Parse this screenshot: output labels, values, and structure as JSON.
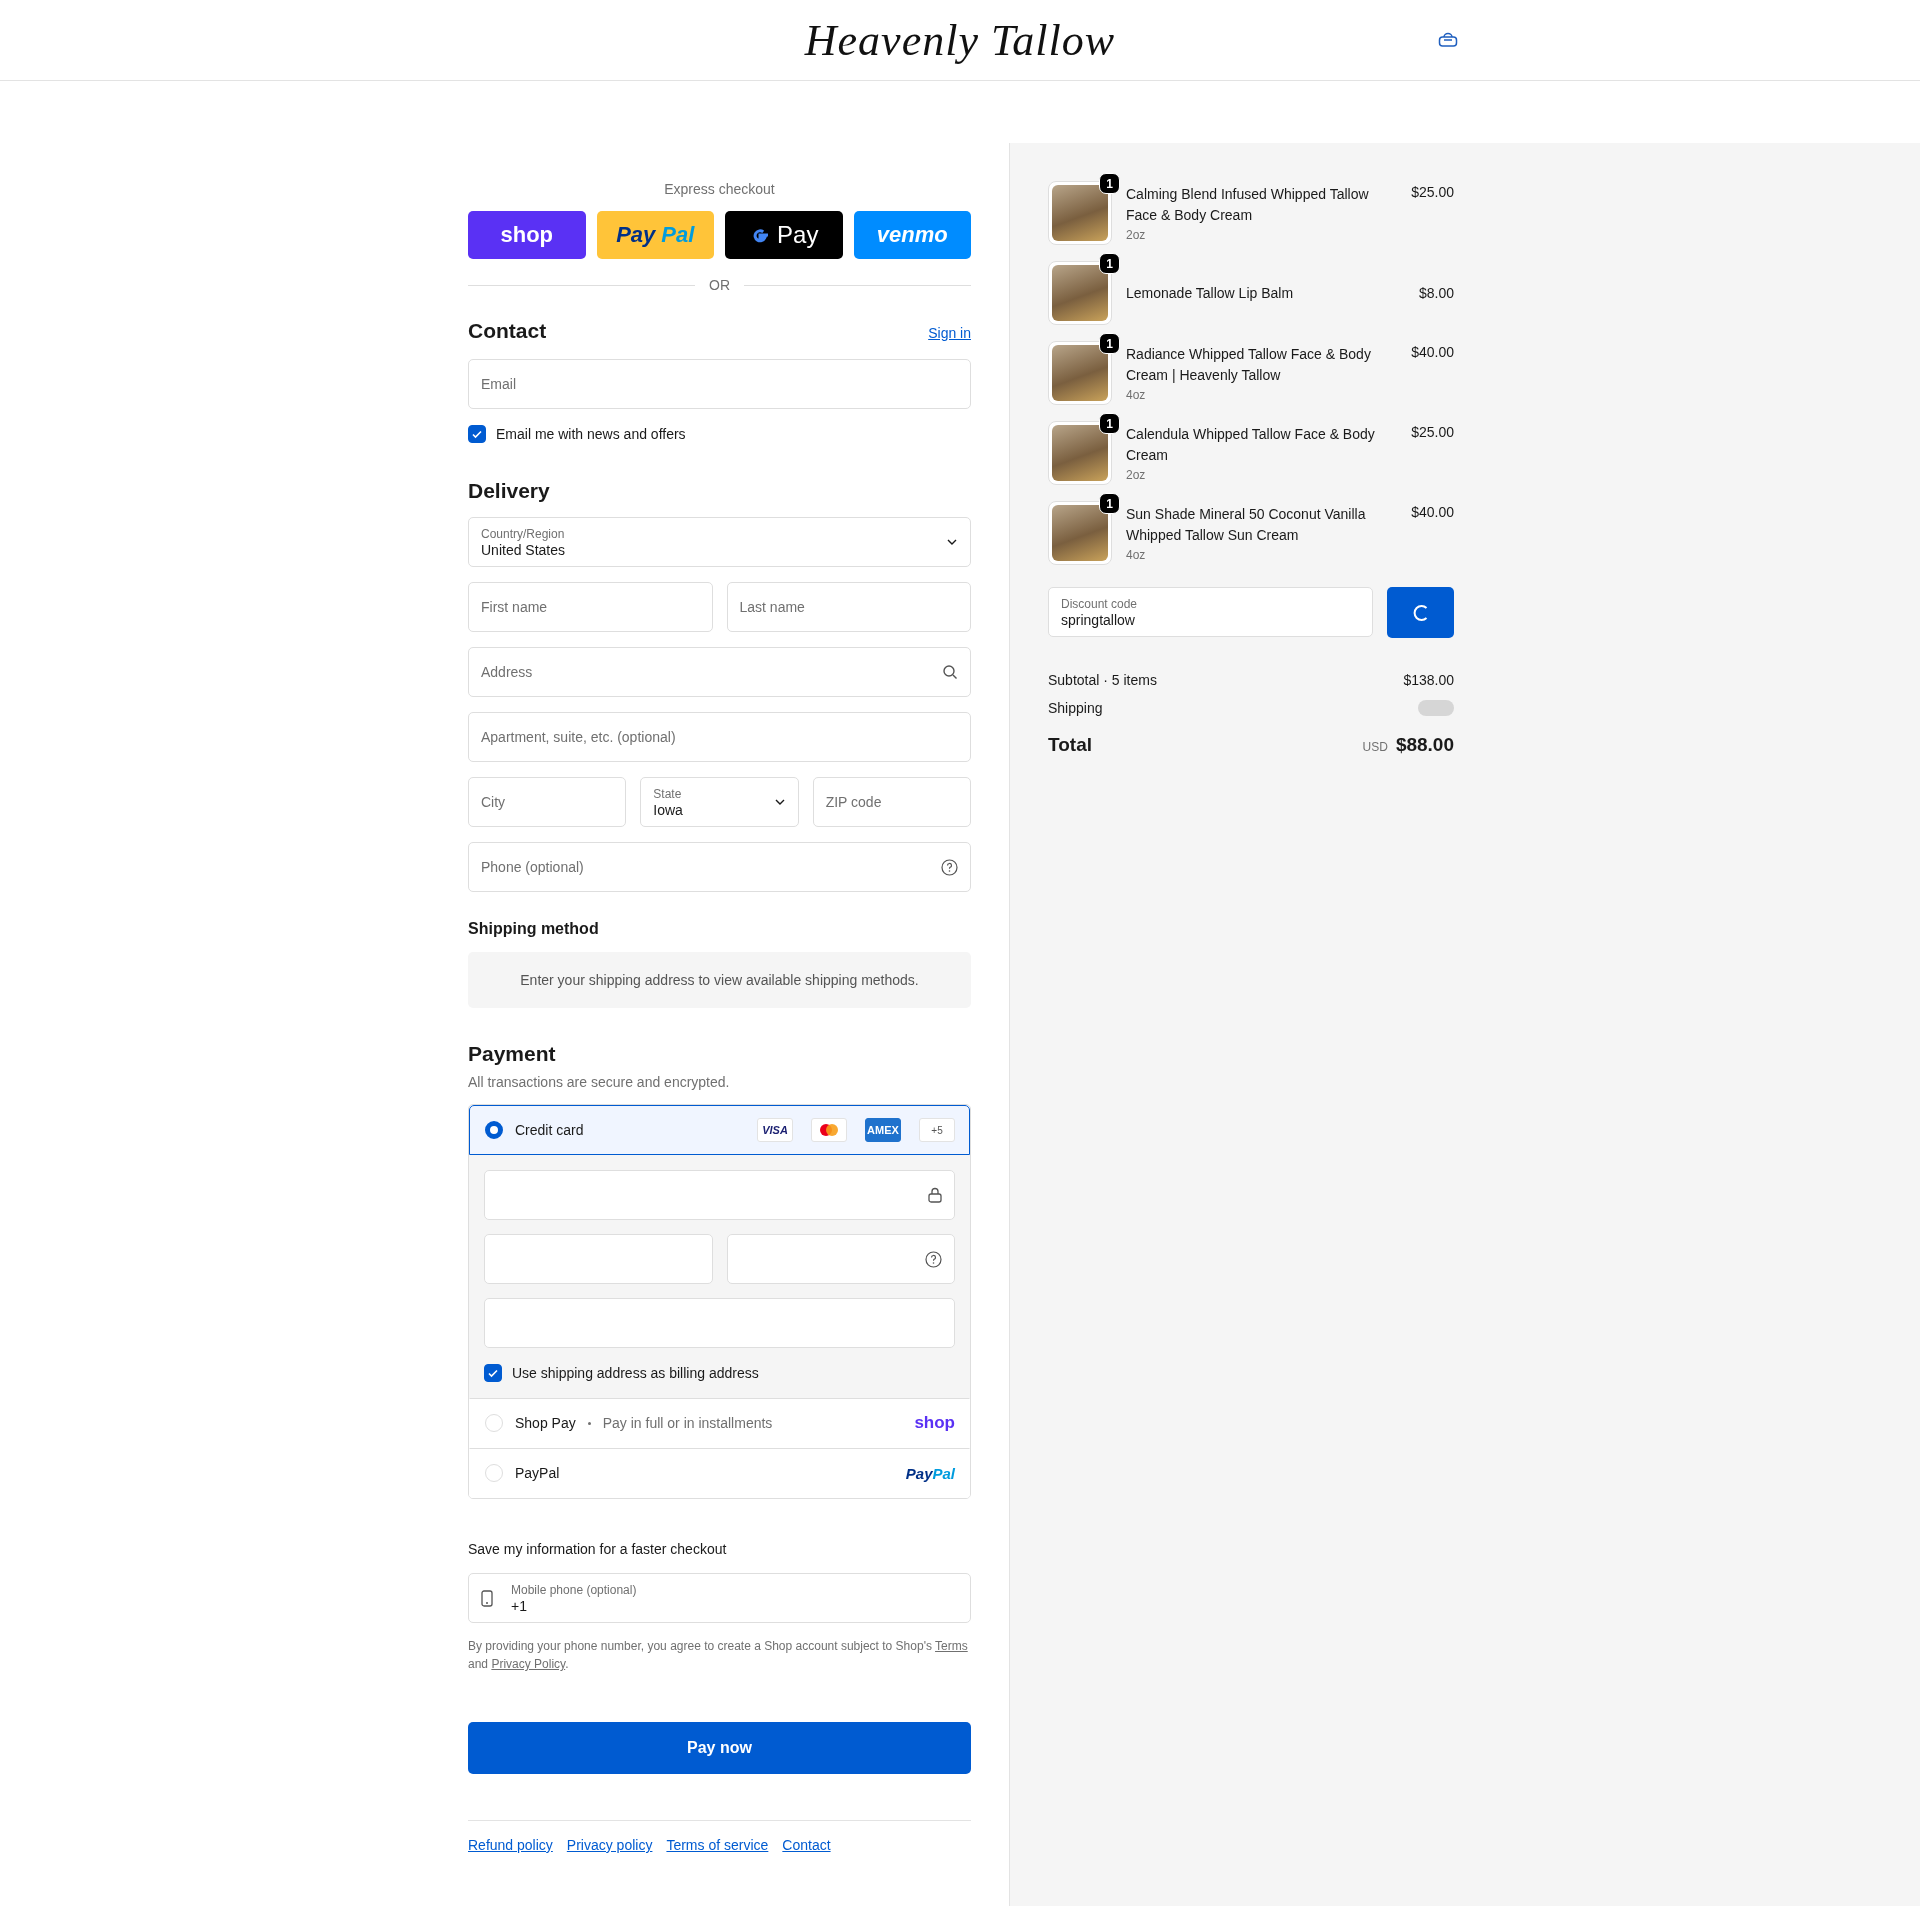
{
  "header": {
    "logo": "Heavenly Tallow"
  },
  "express": {
    "title": "Express checkout",
    "divider": "OR",
    "buttons": [
      {
        "kind": "shop",
        "label": "shop"
      },
      {
        "kind": "paypal",
        "parts": [
          "Pay",
          "Pal"
        ]
      },
      {
        "kind": "gpay",
        "label": "Pay"
      },
      {
        "kind": "venmo",
        "label": "venmo"
      }
    ]
  },
  "contact": {
    "title": "Contact",
    "sign_in": "Sign in",
    "email": {
      "placeholder": "Email"
    },
    "newsletter": {
      "label": "Email me with news and offers",
      "checked": true
    }
  },
  "delivery": {
    "title": "Delivery",
    "rows": [
      [
        {
          "kind": "select",
          "label": "Country/Region",
          "value": "United States"
        }
      ],
      [
        {
          "kind": "text",
          "placeholder": "First name"
        },
        {
          "kind": "text",
          "placeholder": "Last name"
        }
      ],
      [
        {
          "kind": "search",
          "placeholder": "Address"
        }
      ],
      [
        {
          "kind": "text",
          "placeholder": "Apartment, suite, etc. (optional)"
        }
      ],
      [
        {
          "kind": "text",
          "placeholder": "City"
        },
        {
          "kind": "select",
          "label": "State",
          "value": "Iowa"
        },
        {
          "kind": "text",
          "placeholder": "ZIP code"
        }
      ],
      [
        {
          "kind": "help",
          "placeholder": "Phone (optional)"
        }
      ]
    ]
  },
  "shipping_method": {
    "title": "Shipping method",
    "notice": "Enter your shipping address to view available shipping methods."
  },
  "payment": {
    "title": "Payment",
    "subtitle": "All transactions are secure and encrypted.",
    "methods": [
      {
        "kind": "card",
        "label": "Credit card",
        "selected": true,
        "brands": [
          {
            "kind": "visa",
            "label": "VISA"
          },
          {
            "kind": "mastercard"
          },
          {
            "kind": "amex",
            "label": "AMEX"
          },
          {
            "kind": "more",
            "label": "+5"
          }
        ],
        "fields": [
          [
            {
              "kind": "lock"
            }
          ],
          [
            {
              "kind": "plain"
            },
            {
              "kind": "help"
            }
          ],
          [
            {
              "kind": "plain"
            }
          ]
        ],
        "billing": {
          "label": "Use shipping address as billing address",
          "checked": true
        }
      },
      {
        "kind": "shop",
        "label": "Shop Pay",
        "note": "Pay in full or in installments",
        "logo": "shop",
        "selected": false
      },
      {
        "kind": "paypal",
        "label": "PayPal",
        "logo_parts": [
          "Pay",
          "Pal"
        ],
        "selected": false
      }
    ]
  },
  "save_info": {
    "title": "Save my information for a faster checkout",
    "phone": {
      "label": "Mobile phone (optional)",
      "value": "+1"
    },
    "legal": {
      "before": "By providing your phone number, you agree to create a Shop account subject to Shop's",
      "link_1": "Terms",
      "middle": "and",
      "link_2": "Privacy Policy",
      "after": "."
    }
  },
  "pay_button": "Pay now",
  "footer_links": [
    "Refund policy",
    "Privacy policy",
    "Terms of service",
    "Contact"
  ],
  "summary": {
    "items": [
      {
        "name": "Calming Blend Infused Whipped Tallow Face & Body Cream",
        "variant": "2oz",
        "quantity": "1",
        "price": "$25.00"
      },
      {
        "name": "Lemonade Tallow Lip Balm",
        "quantity": "1",
        "price": "$8.00"
      },
      {
        "name": "Radiance Whipped Tallow Face & Body Cream | Heavenly Tallow",
        "variant": "4oz",
        "quantity": "1",
        "price": "$40.00"
      },
      {
        "name": "Calendula Whipped Tallow Face & Body Cream",
        "variant": "2oz",
        "quantity": "1",
        "price": "$25.00"
      },
      {
        "name": "Sun Shade Mineral 50 Coconut Vanilla Whipped Tallow Sun Cream",
        "variant": "4oz",
        "quantity": "1",
        "price": "$40.00"
      }
    ],
    "discount": {
      "label": "Discount code",
      "value": "springtallow"
    },
    "subtotal": {
      "label": "Subtotal · 5 items",
      "value": "$138.00"
    },
    "shipping": {
      "label": "Shipping"
    },
    "total": {
      "label": "Total",
      "currency": "USD",
      "value": "$88.00"
    }
  }
}
